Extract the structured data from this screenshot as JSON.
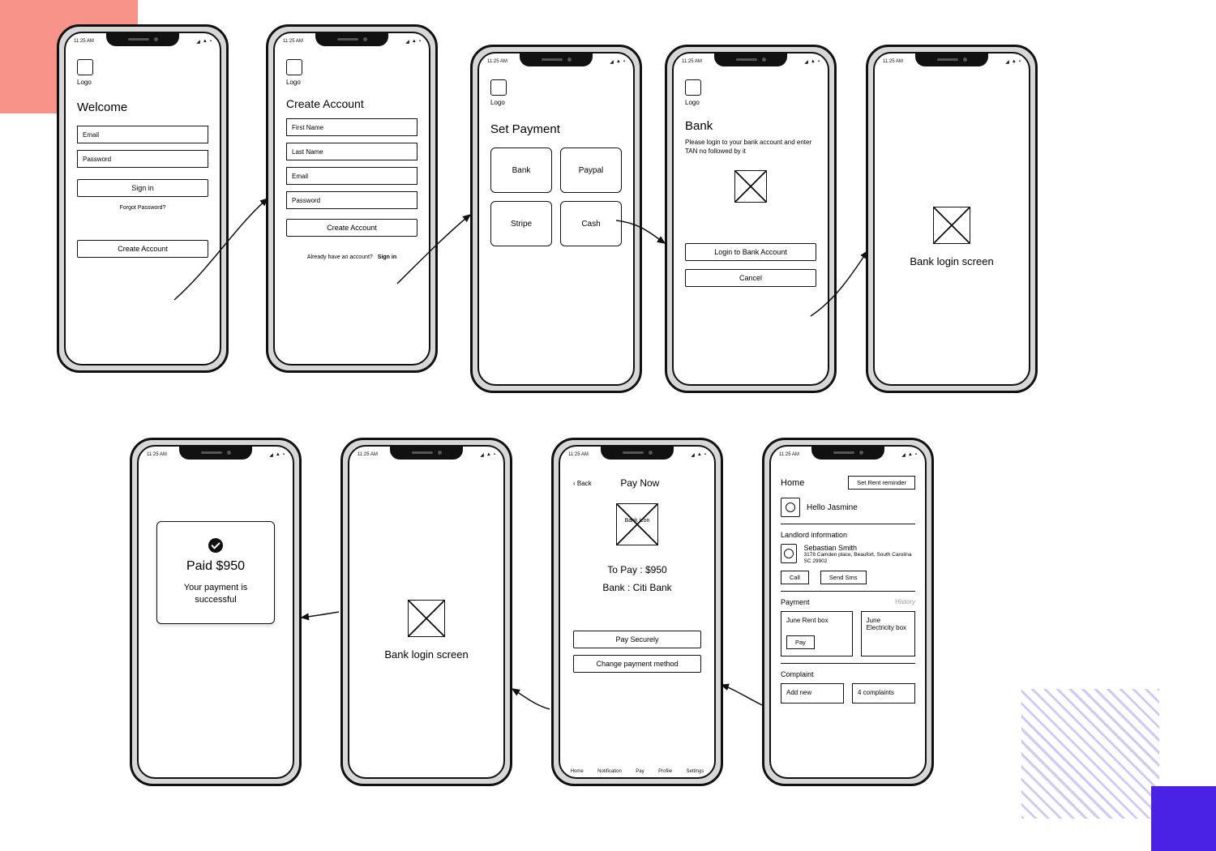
{
  "status": {
    "time": "11:25 AM"
  },
  "logo": {
    "label": "Logo"
  },
  "screens": {
    "welcome": {
      "title": "Welcome",
      "email_ph": "Email",
      "password_ph": "Password",
      "signin": "Sign in",
      "forgot": "Forgot Password?",
      "create": "Create Account"
    },
    "create": {
      "title": "Create Account",
      "first": "First Name",
      "last": "Last Name",
      "email": "Email",
      "password": "Password",
      "btn": "Create Account",
      "already": "Already have an account?",
      "signin": "Sign in"
    },
    "payment": {
      "title": "Set Payment",
      "opts": [
        "Bank",
        "Paypal",
        "Stripe",
        "Cash"
      ]
    },
    "bank": {
      "title": "Bank",
      "desc": "Please login to your bank account and enter TAN no followed by it",
      "login_btn": "Login to Bank Account",
      "cancel": "Cancel"
    },
    "bank_login": {
      "label": "Bank login screen"
    },
    "paid": {
      "amount": "Paid $950",
      "msg": "Your payment is successful"
    },
    "paynow": {
      "back": "Back",
      "title": "Pay Now",
      "icon_label": "Bank icon",
      "to_pay": "To Pay : $950",
      "bank": "Bank : Citi Bank",
      "pay_btn": "Pay Securely",
      "change_btn": "Change payment method",
      "tabs": [
        "Home",
        "Notification",
        "Pay",
        "Profile",
        "Settings"
      ]
    },
    "home": {
      "title": "Home",
      "reminder_btn": "Set Rent reminder",
      "hello": "Hello Jasmine",
      "landlord_section": "Landlord information",
      "landlord_name": "Sebastian Smith",
      "landlord_addr": "3178 Camden place, Beaufort, South Carolina SC 29902",
      "call": "Call",
      "sms": "Send Sms",
      "payment_section": "Payment",
      "history": "History",
      "rent_box": "June Rent box",
      "pay_btn": "Pay",
      "elec_box": "June Electricity box",
      "complaint_section": "Complaint",
      "add_new": "Add new",
      "complaints": "4 complaints"
    }
  }
}
